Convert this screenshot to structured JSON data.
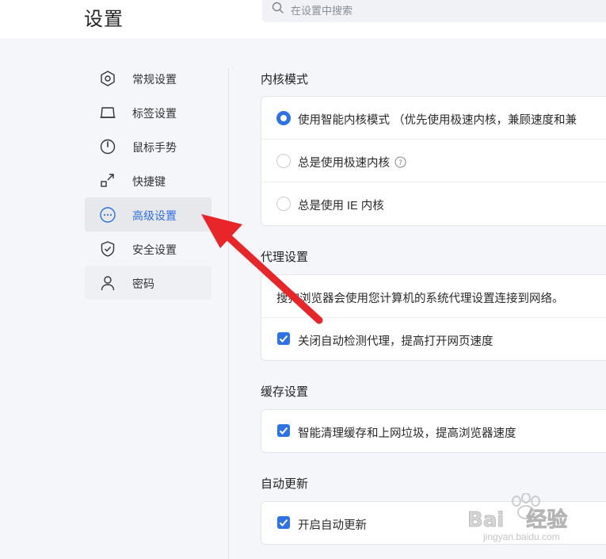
{
  "header": {
    "title": "设置",
    "search_placeholder": "在设置中搜索"
  },
  "sidebar": {
    "items": [
      {
        "label": "常规设置",
        "icon": "hexagon-gear-icon"
      },
      {
        "label": "标签设置",
        "icon": "tab-icon"
      },
      {
        "label": "鼠标手势",
        "icon": "mouse-icon"
      },
      {
        "label": "快捷键",
        "icon": "shortcut-arrow-icon"
      },
      {
        "label": "高级设置",
        "icon": "more-dots-icon",
        "active": true
      },
      {
        "label": "安全设置",
        "icon": "shield-check-icon"
      },
      {
        "label": "密码",
        "icon": "user-icon"
      }
    ]
  },
  "sections": {
    "kernel": {
      "title": "内核模式",
      "options": [
        "使用智能内核模式 （优先使用极速内核，兼顾速度和兼",
        "总是使用极速内核",
        "总是使用 IE 内核"
      ],
      "selected_index": 0
    },
    "proxy": {
      "title": "代理设置",
      "description": "搜狗浏览器会使用您计算机的系统代理设置连接到网络。",
      "checkbox_label": "关闭自动检测代理，提高打开网页速度",
      "checked": true
    },
    "cache": {
      "title": "缓存设置",
      "checkbox_label": "智能清理缓存和上网垃圾，提高浏览器速度",
      "checked": true
    },
    "update": {
      "title": "自动更新",
      "checkbox_label": "开启自动更新",
      "checked": true
    }
  },
  "annotation": {
    "arrow_color": "#e8262a"
  },
  "watermark": {
    "logo_text": "Bai du 经验",
    "url_text": "jingyan.baidu.com"
  },
  "colors": {
    "accent": "#2f72e6",
    "active_text": "#2f6fe0",
    "background": "#f4f6f9"
  }
}
